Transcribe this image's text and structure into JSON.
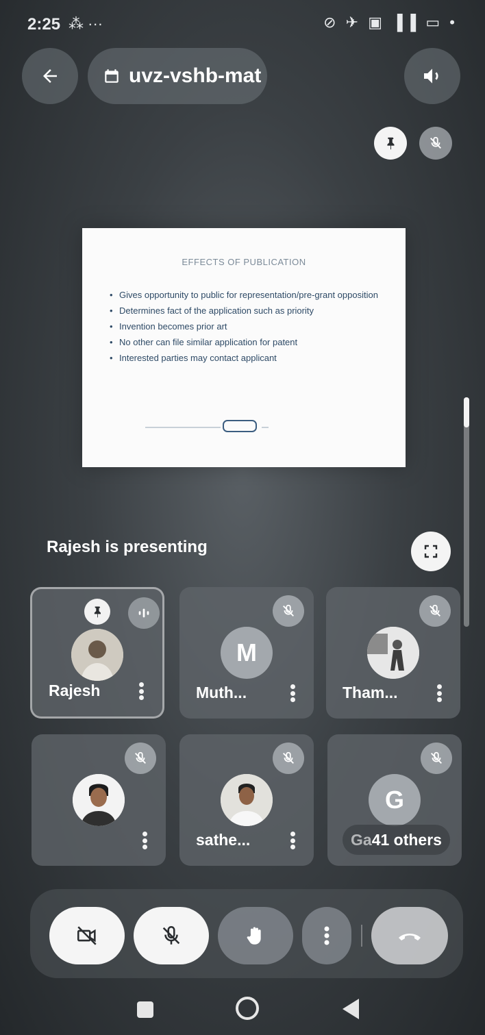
{
  "status_bar": {
    "time": "2:25",
    "left_extras": "⁂ ···",
    "right_icons": "⊘ ✈ ▣ ▐▐ ▭ •"
  },
  "header": {
    "meeting_code": "uvz-vshb-mat",
    "back_icon": "arrow-left-icon",
    "speaker_icon": "speaker-icon"
  },
  "slide": {
    "title": "EFFECTS OF PUBLICATION",
    "bullets": [
      "Gives opportunity to public for representation/pre-grant opposition",
      "Determines fact of the application such as priority",
      "Invention becomes prior art",
      "No other can file similar application for patent",
      "Interested parties may contact applicant"
    ]
  },
  "presenting_text": "Rajesh is presenting",
  "participants": [
    {
      "name": "Rajesh",
      "avatar_type": "photo",
      "pinned": true,
      "speaking": true
    },
    {
      "name": "Muth...",
      "avatar_letter": "M",
      "avatar_type": "letter",
      "muted": true
    },
    {
      "name": "Tham...",
      "avatar_type": "photo",
      "muted": true
    },
    {
      "name": "",
      "avatar_type": "photo",
      "muted": true
    },
    {
      "name": "sathe...",
      "avatar_type": "photo",
      "muted": true
    },
    {
      "name": "Ga",
      "avatar_letter": "G",
      "avatar_type": "letter",
      "muted": true,
      "others_label": "41 others"
    }
  ],
  "colors": {
    "tile_bg": "#5f6469",
    "avatar_letter_bg": "#a3a8ad",
    "control_white": "#f5f5f5"
  }
}
